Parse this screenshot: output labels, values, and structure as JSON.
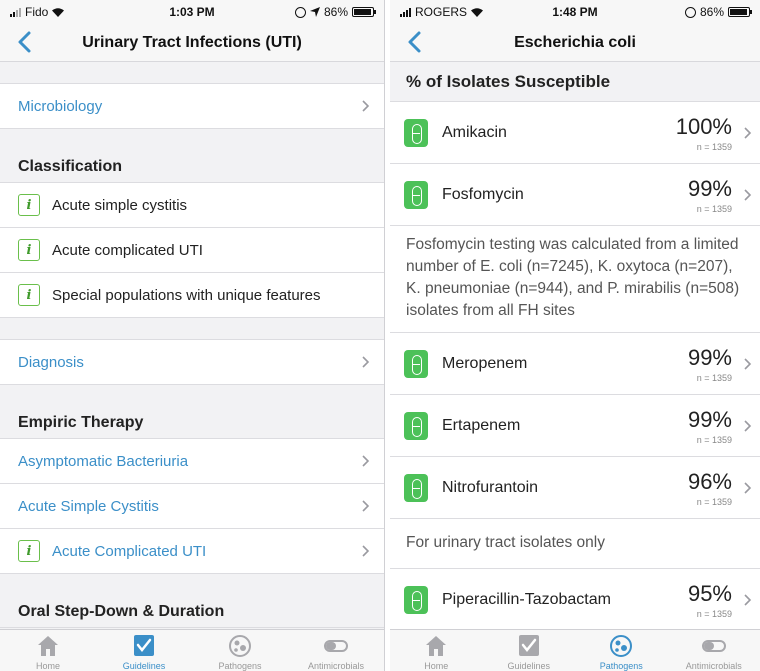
{
  "left": {
    "status": {
      "carrier": "Fido",
      "time": "1:03 PM",
      "battery": "86%"
    },
    "nav": {
      "title": "Urinary Tract Infections (UTI)"
    },
    "microbiology": "Microbiology",
    "classification": {
      "header": "Classification",
      "items": [
        "Acute simple cystitis",
        "Acute complicated UTI",
        "Special populations with unique features"
      ]
    },
    "diagnosis": "Diagnosis",
    "empiric": {
      "header": "Empiric Therapy",
      "items": [
        "Asymptomatic Bacteriuria",
        "Acute Simple Cystitis",
        "Acute Complicated UTI"
      ]
    },
    "oral_header": "Oral Step-Down & Duration",
    "tabs": {
      "home": "Home",
      "guidelines": "Guidelines",
      "pathogens": "Pathogens",
      "antimicrobials": "Antimicrobials"
    }
  },
  "right": {
    "status": {
      "carrier": "ROGERS",
      "time": "1:48 PM",
      "battery": "86%"
    },
    "nav": {
      "title": "Escherichia coli"
    },
    "header": "% of Isolates Susceptible",
    "drugs": [
      {
        "name": "Amikacin",
        "pct": "100%",
        "n": "n = 1359"
      },
      {
        "name": "Fosfomycin",
        "pct": "99%",
        "n": "n = 1359"
      },
      {
        "name": "Meropenem",
        "pct": "99%",
        "n": "n = 1359"
      },
      {
        "name": "Ertapenem",
        "pct": "99%",
        "n": "n = 1359"
      },
      {
        "name": "Nitrofurantoin",
        "pct": "96%",
        "n": "n = 1359"
      },
      {
        "name": "Piperacillin-Tazobactam",
        "pct": "95%",
        "n": "n = 1359"
      }
    ],
    "fosfomycin_note": "Fosfomycin testing was calculated from a limited number of E. coli (n=7245), K. oxytoca (n=207), K. pneumoniae (n=944), and P. mirabilis (n=508) isolates from all FH sites",
    "nitrofurantoin_note": "For urinary tract isolates only",
    "tabs": {
      "home": "Home",
      "guidelines": "Guidelines",
      "pathogens": "Pathogens",
      "antimicrobials": "Antimicrobials"
    }
  },
  "colors": {
    "accent": "#3b8fc8",
    "info_green": "#6abf4b",
    "drug_green": "#4cc158"
  },
  "icons": [
    "back-chevron-icon",
    "chevron-right-icon",
    "info-icon",
    "capsule-icon",
    "home-icon",
    "guidelines-check-icon",
    "pathogens-icon",
    "antimicrobials-toggle-icon"
  ]
}
